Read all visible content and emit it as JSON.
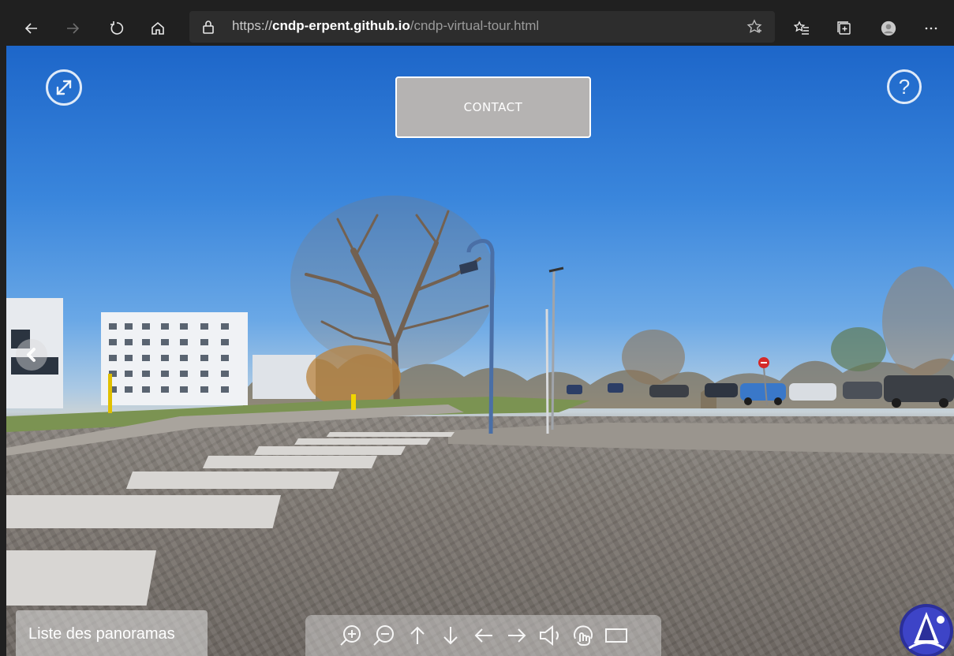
{
  "browser": {
    "url_protocol": "https://",
    "url_host": "cndp-erpent.github.io",
    "url_path": "/cndp-virtual-tour.html",
    "toolbar_icons": [
      "back-icon",
      "forward-icon",
      "refresh-icon",
      "home-icon",
      "lock-icon",
      "favorite-star-icon",
      "favorites-list-icon",
      "collections-icon",
      "profile-avatar-icon",
      "more-icon"
    ]
  },
  "tour": {
    "contact_label": "CONTACT",
    "help_label": "?",
    "panorama_list_label": "Liste des panoramas",
    "controls": [
      "zoom-in-icon",
      "zoom-out-icon",
      "arrow-up-icon",
      "arrow-down-icon",
      "arrow-left-icon",
      "arrow-right-icon",
      "sound-icon",
      "autorotate-icon",
      "screen-icon"
    ],
    "colors": {
      "contact_bg": "#b5b3b2",
      "overlay": "#ffffff",
      "sky": "#3a86dc"
    }
  }
}
